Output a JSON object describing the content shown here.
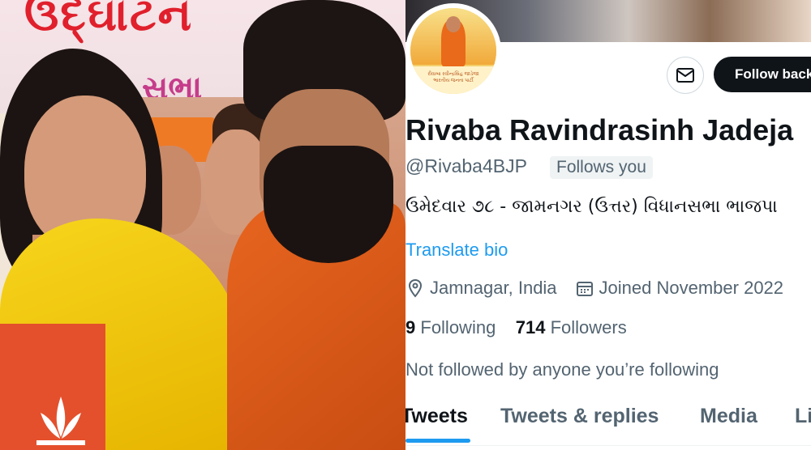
{
  "photo": {
    "banner_text_top": "ઉદ્ઘાટન",
    "banner_text_bottom": "સભા"
  },
  "profile": {
    "avatar_caption": "રીવાબા રવીન્દ્રસિંહ જાડેજા",
    "avatar_party": "ભારતીય જનતા પાર્ટી",
    "follow_button": "Follow back",
    "name": "Rivaba Ravindrasinh Jadeja",
    "handle": "@Rivaba4BJP",
    "follows_you": "Follows you",
    "bio": "ઉમેદવાર ૭૮ - જામનગર (ઉત્તર) વિધાનસભા ભાજપા",
    "translate": "Translate bio",
    "location": "Jamnagar, India",
    "joined": "Joined November 2022",
    "following_count": "9",
    "following_label": "Following",
    "followers_count": "714",
    "followers_label": "Followers",
    "not_followed": "Not followed by anyone you’re following",
    "tabs": [
      "Tweets",
      "Tweets & replies",
      "Media",
      "Likes"
    ]
  },
  "colors": {
    "accent": "#1d9bf0",
    "text_primary": "#0f1419",
    "text_secondary": "#536471",
    "button_dark": "#0f1419"
  }
}
